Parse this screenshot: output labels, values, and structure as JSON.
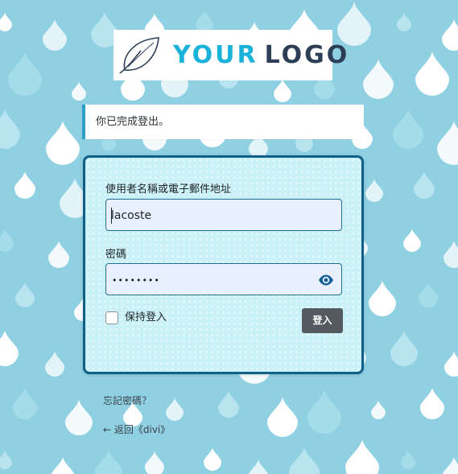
{
  "logo": {
    "word1": "YOUR",
    "word2": "LOGO",
    "icon": "leaf-icon",
    "colors": {
      "word1": "#19b2d9",
      "word2": "#2c3f57"
    }
  },
  "notice": {
    "message": "你已完成登出。",
    "accent": "#2a9fc6"
  },
  "login_form": {
    "username_label": "使用者名稱或電子郵件地址",
    "username_value": "lacoste",
    "password_label": "密碼",
    "password_value": "••••••••",
    "show_password_icon": "eye-icon",
    "remember_label": "保持登入",
    "remember_checked": false,
    "submit_label": "登入",
    "border_color": "#0f5f88"
  },
  "links": {
    "lost_password": "忘記密碼？",
    "back_to_site": "← 返回《divi》"
  },
  "background": {
    "color": "#8fd0e2",
    "pattern": "water-drops"
  }
}
